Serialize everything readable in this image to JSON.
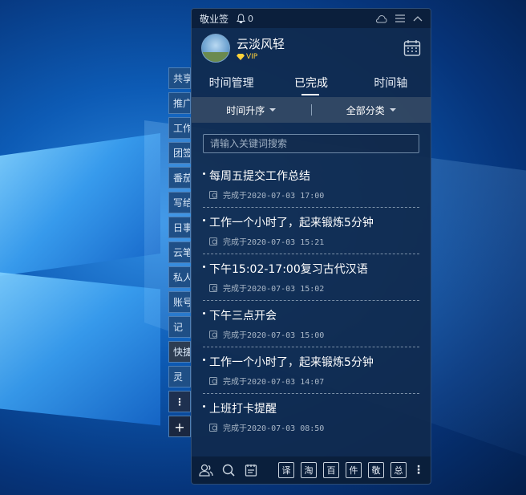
{
  "app": {
    "title": "敬业签",
    "notification_count": "0"
  },
  "user": {
    "name": "云淡风轻",
    "badge": "VIP"
  },
  "tabs": [
    {
      "label": "时间管理"
    },
    {
      "label": "已完成"
    },
    {
      "label": "时间轴"
    }
  ],
  "active_tab": 1,
  "filters": {
    "sort": "时间升序",
    "category": "全部分类"
  },
  "search": {
    "placeholder": "请输入关键词搜索"
  },
  "items": [
    {
      "title": "每周五提交工作总结",
      "completed": "完成于2020-07-03 17:00"
    },
    {
      "title": "工作一个小时了，起来锻炼5分钟",
      "completed": "完成于2020-07-03 15:21"
    },
    {
      "title": "下午15:02-17:00复习古代汉语",
      "completed": "完成于2020-07-03 15:02"
    },
    {
      "title": "下午三点开会",
      "completed": "完成于2020-07-03 15:00"
    },
    {
      "title": "工作一个小时了，起来锻炼5分钟",
      "completed": "完成于2020-07-03 14:07"
    },
    {
      "title": "上班打卡提醒",
      "completed": "完成于2020-07-03 08:50"
    }
  ],
  "side_tabs": [
    "共享",
    "推广",
    "工作",
    "团签",
    "番茄",
    "写给",
    "日事",
    "云笔",
    "私人",
    "账号",
    "记",
    "快捷",
    "灵"
  ],
  "side_tabs_active": 11,
  "bottom_quick": [
    "译",
    "淘",
    "百",
    "件",
    "敬",
    "总"
  ],
  "colors": {
    "panel_bg": "#102a4e",
    "accent": "#ffd23a"
  }
}
